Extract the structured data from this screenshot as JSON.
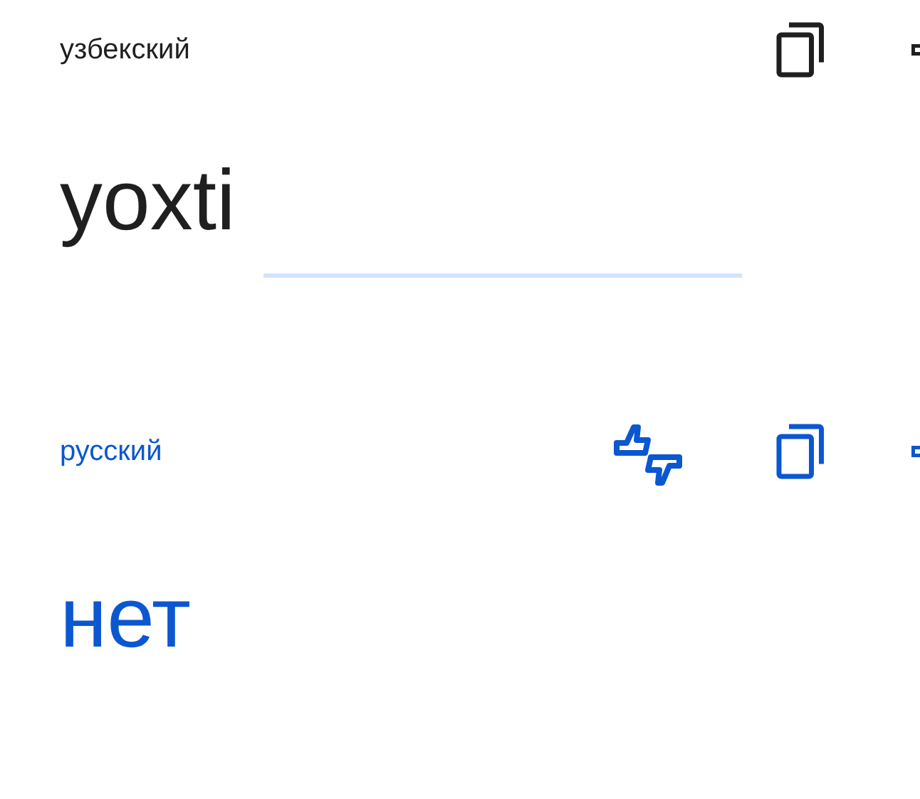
{
  "source": {
    "language": "узбекский",
    "text": "yoxti"
  },
  "target": {
    "language": "русский",
    "text": "нет"
  }
}
